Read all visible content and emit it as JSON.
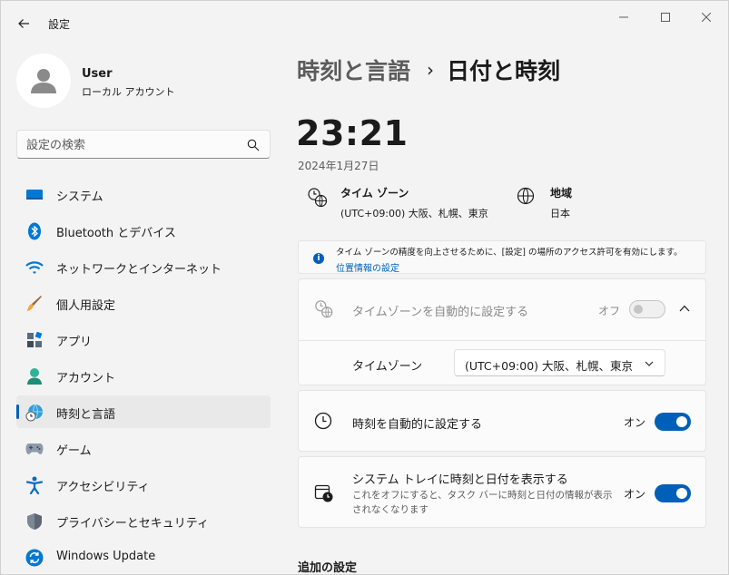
{
  "window": {
    "title": "設定"
  },
  "user": {
    "name": "User",
    "account_type": "ローカル アカウント"
  },
  "search": {
    "placeholder": "設定の検索"
  },
  "sidebar": {
    "items": [
      {
        "label": "システム",
        "icon": "system-icon"
      },
      {
        "label": "Bluetooth とデバイス",
        "icon": "bluetooth-icon"
      },
      {
        "label": "ネットワークとインターネット",
        "icon": "wifi-icon"
      },
      {
        "label": "個人用設定",
        "icon": "paintbrush-icon"
      },
      {
        "label": "アプリ",
        "icon": "apps-icon"
      },
      {
        "label": "アカウント",
        "icon": "account-icon"
      },
      {
        "label": "時刻と言語",
        "icon": "globe-clock-icon",
        "active": true
      },
      {
        "label": "ゲーム",
        "icon": "gamepad-icon"
      },
      {
        "label": "アクセシビリティ",
        "icon": "accessibility-icon"
      },
      {
        "label": "プライバシーとセキュリティ",
        "icon": "shield-icon"
      },
      {
        "label": "Windows Update",
        "icon": "update-icon"
      }
    ]
  },
  "breadcrumb": {
    "parent": "時刻と言語",
    "separator": "›",
    "current": "日付と時刻"
  },
  "clock": {
    "time": "23:21",
    "date": "2024年1月27日"
  },
  "timezone_info": {
    "title": "タイム ゾーン",
    "value": "(UTC+09:00) 大阪、札幌、東京"
  },
  "region_info": {
    "title": "地域",
    "value": "日本"
  },
  "notice": {
    "text": "タイム ゾーンの精度を向上させるために、[設定] の場所のアクセス許可を有効にします。",
    "link": "位置情報の設定"
  },
  "auto_timezone": {
    "title": "タイムゾーンを自動的に設定する",
    "state_label": "オフ",
    "enabled": false,
    "timezone_label": "タイムゾーン",
    "timezone_value": "(UTC+09:00) 大阪、札幌、東京"
  },
  "auto_time": {
    "title": "時刻を自動的に設定する",
    "state_label": "オン",
    "enabled": true
  },
  "tray_time": {
    "title": "システム トレイに時刻と日付を表示する",
    "description": "これをオフにすると、タスク バーに時刻と日付の情報が表示されなくなります",
    "state_label": "オン",
    "enabled": true
  },
  "additional": {
    "title": "追加の設定"
  },
  "colors": {
    "accent": "#005fb8",
    "background": "#f3f3f3",
    "card": "#fbfbfb"
  }
}
